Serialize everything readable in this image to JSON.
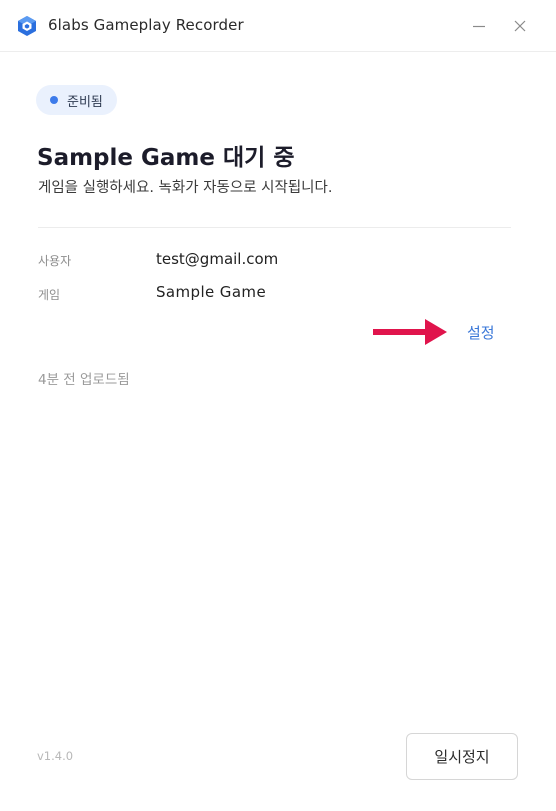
{
  "window": {
    "title": "6labs Gameplay Recorder"
  },
  "status": {
    "label": "준비됨",
    "color": "#3d7bea"
  },
  "main": {
    "game_name": "Sample Game",
    "heading_suffix": " 대기 중",
    "subheading": "게임을 실행하세요. 녹화가 자동으로 시작됩니다."
  },
  "info": {
    "user_label": "사용자",
    "user_value": "test@gmail.com",
    "game_label": "게임",
    "game_value": "Sample Game"
  },
  "settings": {
    "label": "설정",
    "link_color": "#3b78d8",
    "arrow_color": "#e0144c"
  },
  "upload_status": "4분 전 업로드됨",
  "footer": {
    "version": "v1.4.0",
    "pause_label": "일시정지"
  },
  "icons": {
    "app": "app-logo-icon",
    "minimize": "minimize-icon",
    "close": "close-icon",
    "arrow": "arrow-right-icon"
  }
}
